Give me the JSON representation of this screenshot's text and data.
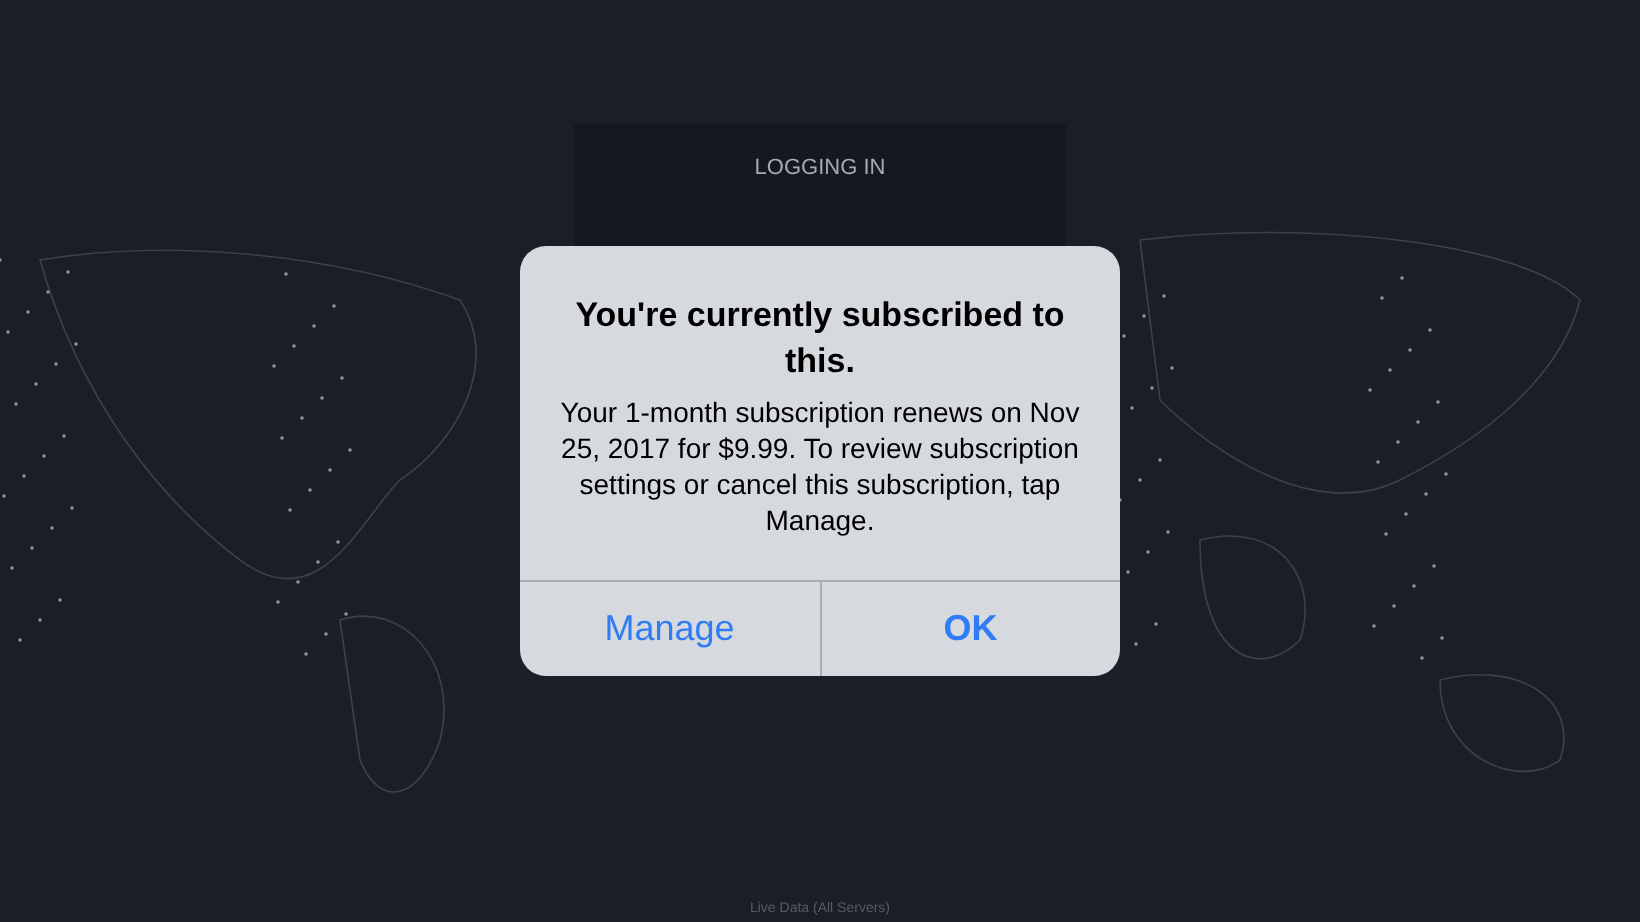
{
  "panel": {
    "title": "LOGGING IN"
  },
  "alert": {
    "title": "You're currently subscribed to this.",
    "message": "Your 1-month subscription renews on Nov 25, 2017 for $9.99. To review subscription settings or cancel this subscription, tap Manage.",
    "buttons": [
      {
        "label": "Manage",
        "kind": "normal"
      },
      {
        "label": "OK",
        "kind": "default"
      }
    ]
  },
  "footer": "Live Data (All Servers)"
}
